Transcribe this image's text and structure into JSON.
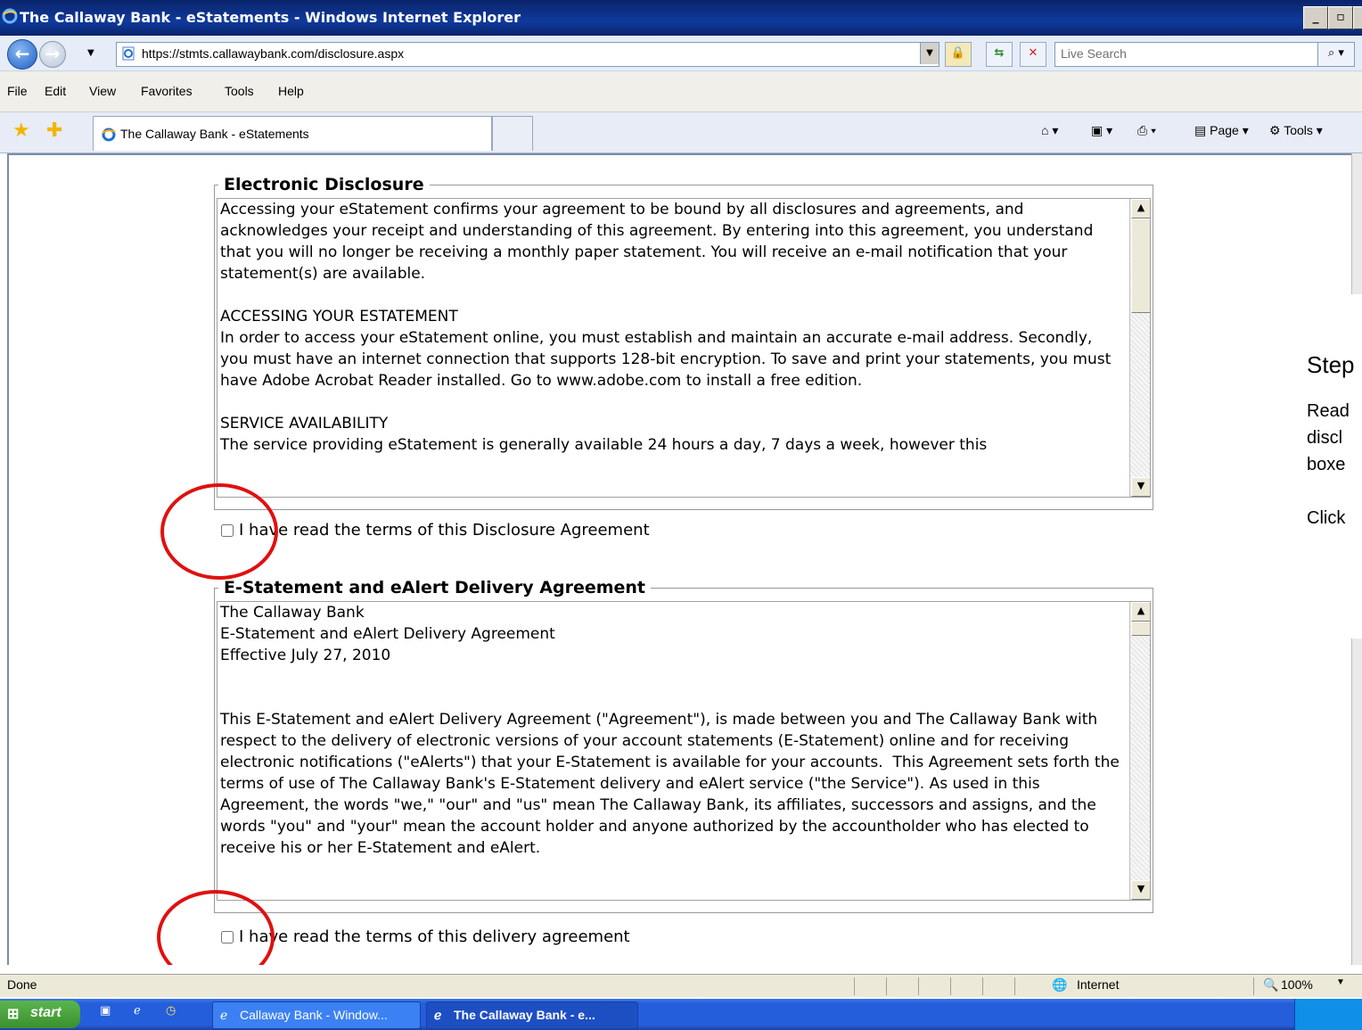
{
  "window": {
    "title": "The Callaway Bank - eStatements - Windows Internet Explorer",
    "min": "_",
    "max": "▫",
    "close": "✕"
  },
  "address": {
    "url": "https://stmts.callawaybank.com/disclosure.aspx",
    "search_placeholder": "Live Search"
  },
  "menu": [
    "File",
    "Edit",
    "View",
    "Favorites",
    "Tools",
    "Help"
  ],
  "tab": {
    "label": "The Callaway Bank - eStatements"
  },
  "command_bar": {
    "page": "Page",
    "tools": "Tools"
  },
  "disclosure": {
    "legend": "Electronic Disclosure",
    "text": "Accessing your eStatement confirms your agreement to be bound by all disclosures and agreements, and acknowledges your receipt and understanding of this agreement. By entering into this agreement, you understand that you will no longer be receiving a monthly paper statement. You will receive an e-mail notification that your statement(s) are available.\n\nACCESSING YOUR ESTATEMENT\nIn order to access your eStatement online, you must establish and maintain an accurate e-mail address. Secondly, you must have an internet connection that supports 128-bit encryption. To save and print your statements, you must have Adobe Acrobat Reader installed. Go to www.adobe.com to install a free edition.\n\nSERVICE AVAILABILITY\nThe service providing eStatement is generally available 24 hours a day, 7 days a week, however this",
    "checkbox_label": "I have read the terms of this Disclosure Agreement"
  },
  "delivery": {
    "legend": "E-Statement and eAlert Delivery Agreement",
    "text": "The Callaway Bank\nE-Statement and eAlert Delivery Agreement\nEffective July 27, 2010\n\n\nThis E-Statement and eAlert Delivery Agreement (\"Agreement\"), is made between you and The Callaway Bank with respect to the delivery of electronic versions of your account statements (E-Statement) online and for receiving electronic notifications (\"eAlerts\") that your E-Statement is available for your accounts.  This Agreement sets forth the terms of use of The Callaway Bank's E-Statement delivery and eAlert service (\"the Service\"). As used in this Agreement, the words \"we,\" \"our\" and \"us\" mean The Callaway Bank, its affiliates, successors and assigns, and the words \"you\" and \"your\" mean the account holder and anyone authorized by the accountholder who has elected to receive his or her E-Statement and eAlert.",
    "checkbox_label": "I have read the terms of this delivery agreement"
  },
  "step_panel": {
    "heading": "Step",
    "lines": [
      "Read",
      "discl",
      "boxe",
      "Click"
    ]
  },
  "status": {
    "text": "Done",
    "zone": "Internet",
    "zoom": "100%"
  },
  "taskbar": {
    "start": "start",
    "items": [
      "Callaway Bank - Window...",
      "The Callaway Bank - e..."
    ]
  },
  "colors": {
    "titlebar": "#0a246a",
    "annotation": "#e01010"
  }
}
